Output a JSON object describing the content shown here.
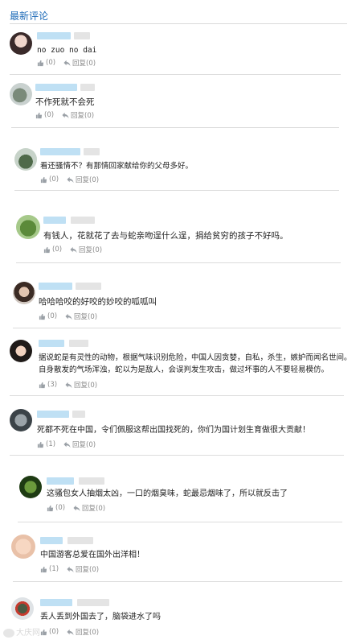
{
  "header": {
    "title": "最新评论"
  },
  "like_count_text": "(0)",
  "comments": [
    {
      "text": "no zuo no dai",
      "likes": "(0)",
      "reply": "回复(0)"
    },
    {
      "text": "不作死就不会死",
      "likes": "(0)",
      "reply": "回复(0)"
    },
    {
      "text": "看还骚情不？有那情回家献给你的父母多好。",
      "likes": "(0)",
      "reply": "回复(0)"
    },
    {
      "text": "有钱人，花就花了去与蛇亲吻逞什么逞，捐给贫穷的孩子不好吗。",
      "likes": "(0)",
      "reply": "回复(0)"
    },
    {
      "text": "哈哈哈咬的好咬的妙咬的呱呱叫",
      "likes": "(0)",
      "reply": "回复(0)"
    },
    {
      "text": "据说蛇是有灵性的动物，根据气味识别危险，中国人因贪婪，自私，杀生，嫉妒而闻名世间。自身散发的气场浑浊，蛇以为是敌人，会误判发生攻击，做过坏事的人不要轻易模仿。",
      "likes": "(3)",
      "reply": "回复(0)"
    },
    {
      "text": "死都不死在中国，令们佩服这帮出国找死的，你们为国计划生育做很大贡献！",
      "likes": "(1)",
      "reply": "回复(0)"
    },
    {
      "text": "这骚包女人抽烟太凶，一口的烟臭味，蛇最忌烟味了，所以就反击了",
      "likes": "(0)",
      "reply": "回复(0)"
    },
    {
      "text": "中国游客总爱在国外出洋相！",
      "likes": "(1)",
      "reply": "回复(0)"
    },
    {
      "text": "丢人丢到外国去了，脑袋进水了吗",
      "likes": "(0)",
      "reply": "回复(0)"
    }
  ],
  "watermark": {
    "text": "大庆网"
  },
  "icons": {
    "like": "thumbs-up-icon",
    "reply": "reply-arrow-icon"
  },
  "colors": {
    "accent": "#1e6bb8",
    "name_blur": "#bfe0f4",
    "muted": "#8a8a8a"
  }
}
